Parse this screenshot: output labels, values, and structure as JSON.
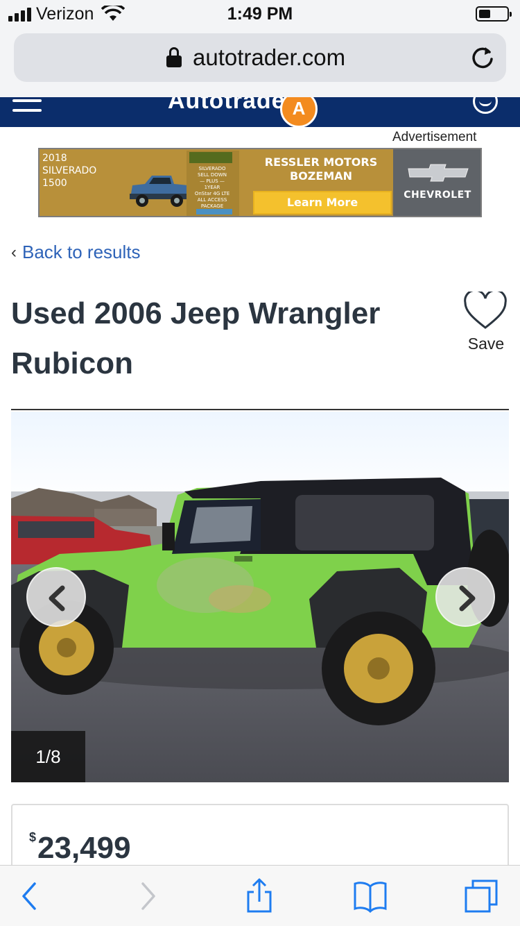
{
  "status_bar": {
    "carrier": "Verizon",
    "time": "1:49 PM"
  },
  "browser": {
    "url": "autotrader.com"
  },
  "site_header": {
    "logo_text": "Autotrader"
  },
  "ad": {
    "label": "Advertisement",
    "model_lines": [
      "2018",
      "SILVERADO",
      "1500"
    ],
    "promo_lines": [
      "SILVERADO",
      "SELL DOWN",
      "— PLUS —",
      "1YEAR",
      "OnStar 4G LTE",
      "ALL ACCESS",
      "PACKAGE"
    ],
    "dealer_lines": [
      "RESSLER MOTORS",
      "BOZEMAN"
    ],
    "cta": "Learn More",
    "brand": "CHEVROLET",
    "colors": {
      "background": "#b8903a",
      "cta": "#f4c12d",
      "brand_panel": "#5f6368"
    }
  },
  "back_link": {
    "label": "Back to results"
  },
  "listing": {
    "title": "Used 2006 Jeep Wrangler Rubicon",
    "save_label": "Save",
    "photo_counter": "1/8",
    "price_symbol": "$",
    "price": "23,499"
  },
  "icons": [
    "signal-icon",
    "wifi-icon",
    "battery-icon",
    "lock-icon",
    "reload-icon",
    "menu-icon",
    "account-icon",
    "heart-icon",
    "chevron-left-icon",
    "chevron-right-icon",
    "back-icon",
    "forward-icon",
    "share-icon",
    "bookmarks-icon",
    "tabs-icon"
  ],
  "colors": {
    "header": "#0b2d6b",
    "link": "#2e63b8",
    "ios_blue": "#1e7cf0"
  }
}
